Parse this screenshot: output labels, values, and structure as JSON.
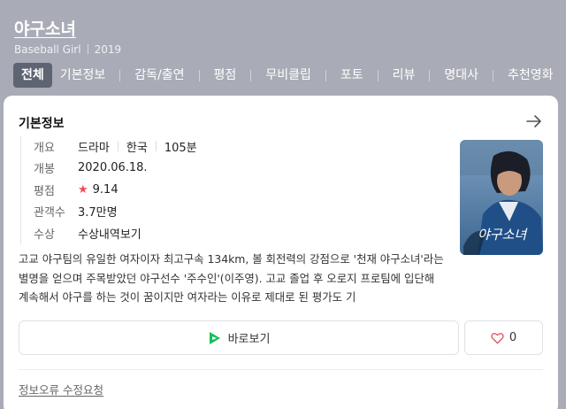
{
  "header": {
    "title": "야구소녀",
    "original_title": "Baseball Girl",
    "year": "2019",
    "tabs": [
      {
        "label": "전체",
        "active": true
      },
      {
        "label": "기본정보"
      },
      {
        "label": "감독/출연"
      },
      {
        "label": "평점"
      },
      {
        "label": "무비클립"
      },
      {
        "label": "포토"
      },
      {
        "label": "리뷰"
      },
      {
        "label": "명대사"
      },
      {
        "label": "추천영화"
      }
    ]
  },
  "card": {
    "title": "기본정보",
    "rows": {
      "overview": {
        "label": "개요",
        "genre": "드라마",
        "country": "한국",
        "runtime": "105분"
      },
      "release": {
        "label": "개봉",
        "value": "2020.06.18."
      },
      "rating": {
        "label": "평점",
        "value": "9.14"
      },
      "audience": {
        "label": "관객수",
        "value": "3.7만명"
      },
      "awards": {
        "label": "수상",
        "value": "수상내역보기"
      }
    },
    "description": "고교 야구팀의 유일한 여자이자 최고구속 134km, 볼 회전력의 강점으로 '천재 야구소녀'라는 별명을 얻으며 주목받았던 야구선수 '주수인'(이주영). 고교 졸업 후 오로지 프로팀에 입단해 계속해서 야구를 하는 것이 꿈이지만 여자라는 이유로 제대로 된 평가도 기",
    "watch_button": "바로보기",
    "like_count": "0",
    "report_link": "정보오류 수정요청"
  },
  "colors": {
    "header_bg": "#a9acb6",
    "active_tab_bg": "#5f6473",
    "star": "#f0485a",
    "link": "#2e50b4",
    "play_icon": "#11c258"
  },
  "icons": [
    "arrow-right-icon",
    "star-icon",
    "play-icon",
    "heart-icon"
  ]
}
